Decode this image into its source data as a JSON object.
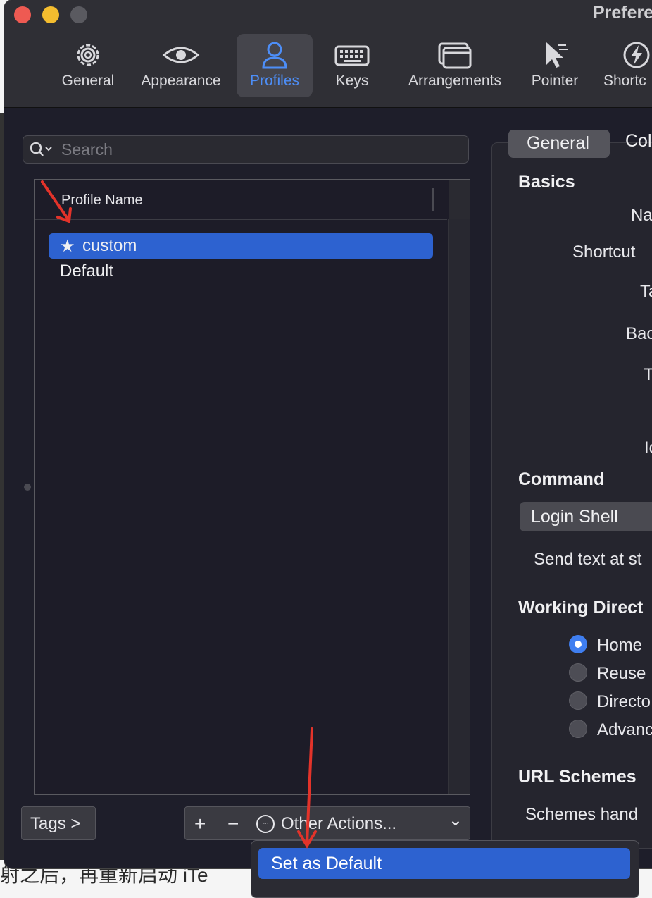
{
  "window": {
    "title": "Prefere"
  },
  "toolbar": {
    "items": [
      {
        "label": "General",
        "icon": "gear-icon"
      },
      {
        "label": "Appearance",
        "icon": "eye-icon"
      },
      {
        "label": "Profiles",
        "icon": "person-icon",
        "active": true
      },
      {
        "label": "Keys",
        "icon": "keyboard-icon"
      },
      {
        "label": "Arrangements",
        "icon": "windows-icon"
      },
      {
        "label": "Pointer",
        "icon": "pointer-icon"
      },
      {
        "label": "Shortc",
        "icon": "bolt-icon"
      }
    ]
  },
  "search": {
    "placeholder": "Search",
    "value": ""
  },
  "profiles": {
    "column_header": "Profile Name",
    "rows": [
      {
        "name": "custom",
        "default_star": "★",
        "selected": true
      },
      {
        "name": "Default",
        "selected": false
      }
    ]
  },
  "bottom_bar": {
    "tags_label": "Tags >",
    "add_label": "+",
    "remove_label": "−",
    "other_actions_label": "Other Actions...",
    "chevron": "⌄",
    "ellipsis_icon": "···"
  },
  "context_menu": {
    "items": [
      {
        "label": "Set as Default"
      }
    ]
  },
  "detail": {
    "tabs": [
      "General",
      "Col"
    ],
    "sections": {
      "basics": "Basics",
      "command": "Command",
      "working_directory": "Working Direct",
      "url_schemes": "URL Schemes"
    },
    "basics_labels": [
      "Na",
      "Shortcut",
      "Ta",
      "Bac",
      "T",
      "Ic"
    ],
    "command_popup": "Login Shell",
    "send_text": "Send text at st",
    "wd_options": [
      {
        "label": "Home",
        "selected": true
      },
      {
        "label": "Reuse",
        "selected": false
      },
      {
        "label": "Directo",
        "selected": false
      },
      {
        "label": "Advanc",
        "selected": false
      }
    ],
    "schemes_label": "Schemes hand"
  },
  "background_text": {
    "bottom_line": "射之后，再重新启动 iTe"
  },
  "colors": {
    "accent": "#2d62d0",
    "active_tab_text": "#4d8ef7",
    "annotation_arrow": "#e3332a"
  }
}
